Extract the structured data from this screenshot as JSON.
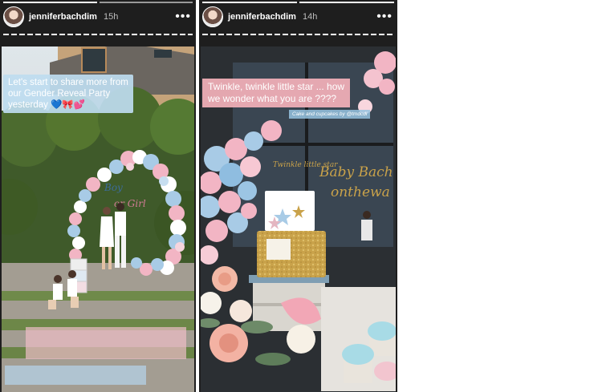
{
  "stories": [
    {
      "username": "jenniferbachdim",
      "time": "15h",
      "caption_line1": "Let's start to share more from",
      "caption_line2": "our Gender Reveal Party",
      "caption_line3": "yesterday 💙🎀💕",
      "arch_text1": "Boy",
      "arch_text2": "or Girl"
    },
    {
      "username": "jenniferbachdim",
      "time": "14h",
      "caption_line1": "Twinkle, twinkle little star ... how",
      "caption_line2": "we wonder what you are ????",
      "credit": "Cake and cupcakes by @tmdcdl",
      "sign_text1": "Baby Bach",
      "sign_text2": "onthewa",
      "topper_text": "Twinkle little star"
    }
  ],
  "colors": {
    "pink": "#f2b5c4",
    "blue": "#a8cbe6",
    "gold": "#c9a24a"
  }
}
